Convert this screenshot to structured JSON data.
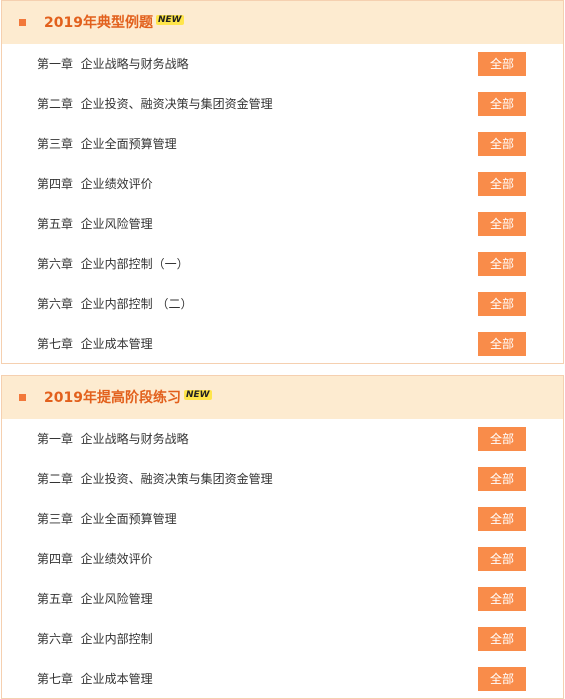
{
  "sections": [
    {
      "title": "2019年典型例题",
      "badge": "NEW",
      "rows": [
        {
          "label": "第一章  企业战略与财务战略",
          "button": "全部"
        },
        {
          "label": "第二章  企业投资、融资决策与集团资金管理",
          "button": "全部"
        },
        {
          "label": "第三章  企业全面预算管理",
          "button": "全部"
        },
        {
          "label": "第四章  企业绩效评价",
          "button": "全部"
        },
        {
          "label": "第五章  企业风险管理",
          "button": "全部"
        },
        {
          "label": "第六章  企业内部控制（一）",
          "button": "全部"
        },
        {
          "label": "第六章  企业内部控制 （二）",
          "button": "全部"
        },
        {
          "label": "第七章  企业成本管理",
          "button": "全部"
        }
      ]
    },
    {
      "title": "2019年提高阶段练习",
      "badge": "NEW",
      "rows": [
        {
          "label": "第一章  企业战略与财务战略",
          "button": "全部"
        },
        {
          "label": "第二章  企业投资、融资决策与集团资金管理",
          "button": "全部"
        },
        {
          "label": "第三章  企业全面预算管理",
          "button": "全部"
        },
        {
          "label": "第四章  企业绩效评价",
          "button": "全部"
        },
        {
          "label": "第五章  企业风险管理",
          "button": "全部"
        },
        {
          "label": "第六章  企业内部控制",
          "button": "全部"
        },
        {
          "label": "第七章  企业成本管理",
          "button": "全部"
        }
      ]
    }
  ],
  "colors": {
    "accent": "#f98c4a",
    "title": "#e2601c",
    "header_bg": "#fdebd0",
    "border": "#f5d0b0",
    "badge_bg": "#ffe54a"
  },
  "icons": {
    "bullet": "square-bullet-icon"
  }
}
